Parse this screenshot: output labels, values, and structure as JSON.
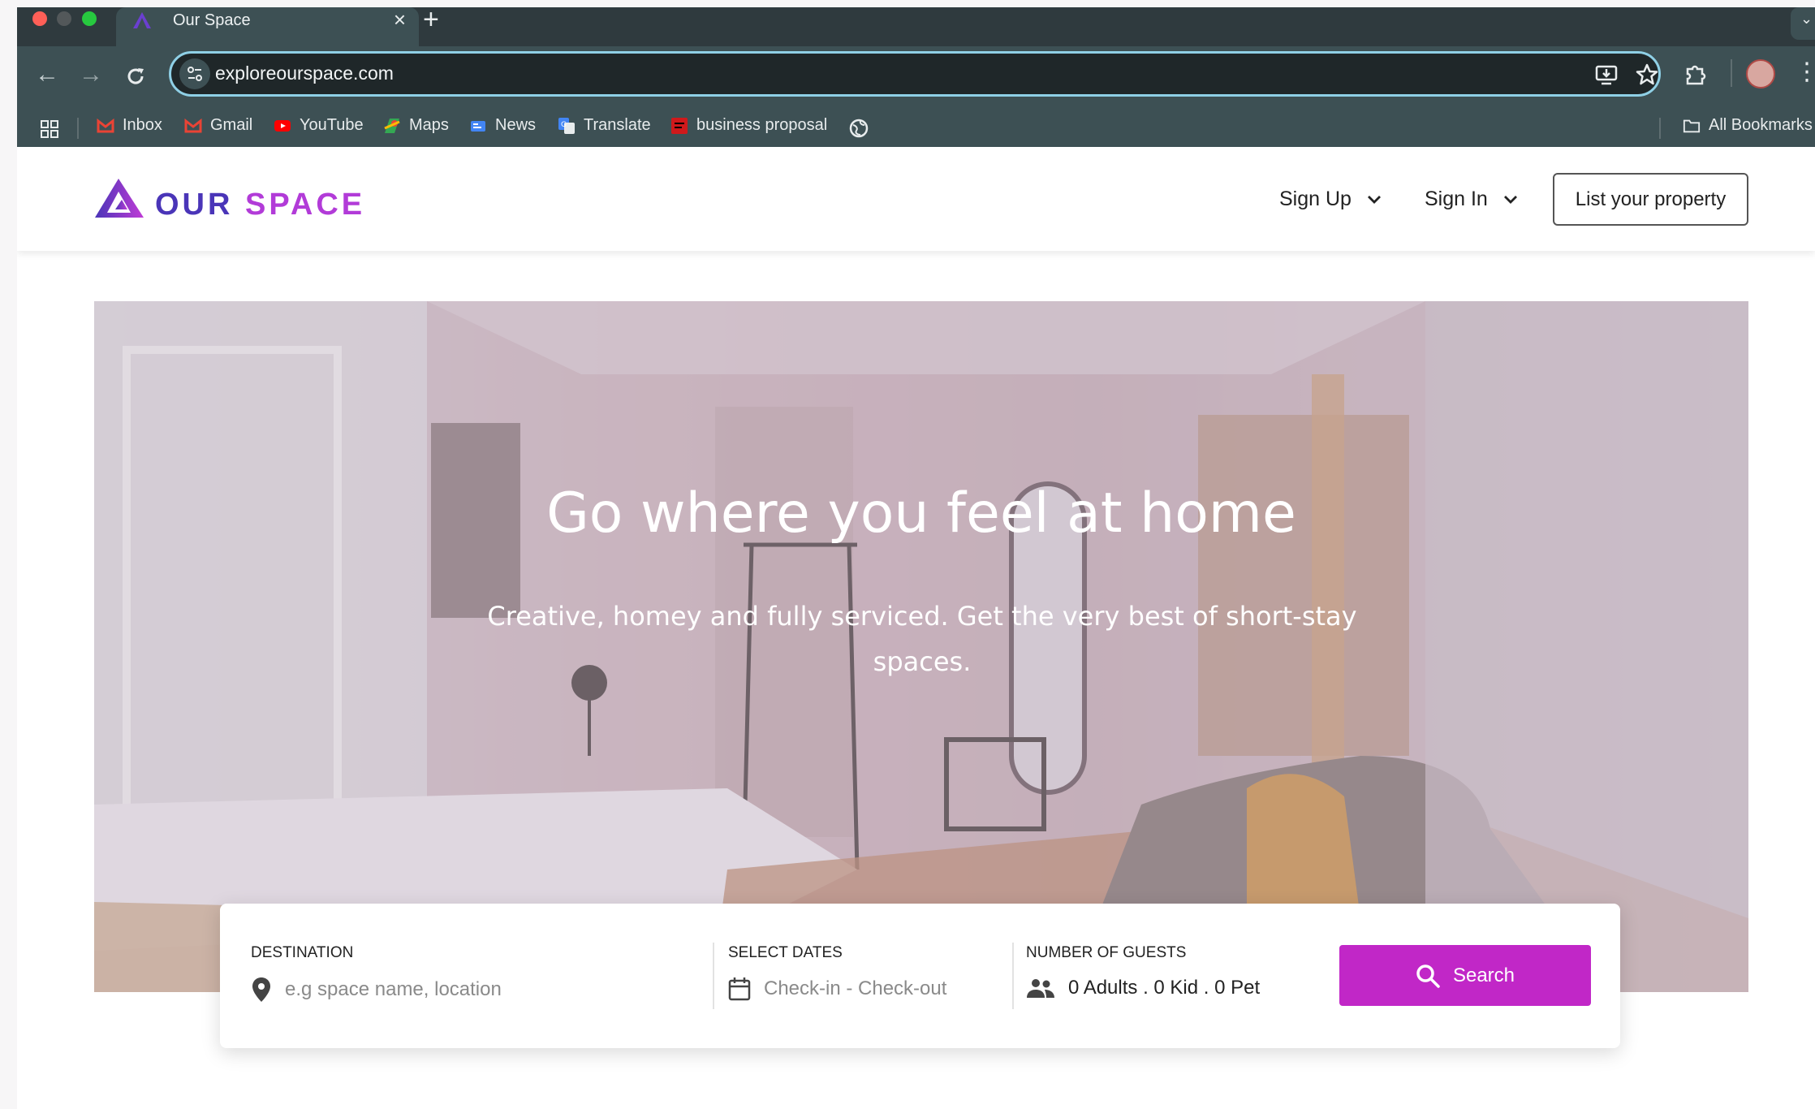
{
  "browser": {
    "tab_title": "Our Space",
    "url": "exploreourspace.com",
    "bookmarks": [
      {
        "label": "Inbox",
        "icon": "gmail-icon"
      },
      {
        "label": "Gmail",
        "icon": "gmail-icon"
      },
      {
        "label": "YouTube",
        "icon": "youtube-icon"
      },
      {
        "label": "Maps",
        "icon": "maps-icon"
      },
      {
        "label": "News",
        "icon": "news-icon"
      },
      {
        "label": "Translate",
        "icon": "translate-icon"
      },
      {
        "label": "business proposal",
        "icon": "document-icon"
      }
    ],
    "all_bookmarks": "All Bookmarks"
  },
  "site": {
    "logo_our": "OUR",
    "logo_space": "SPACE",
    "nav": {
      "sign_up": "Sign Up",
      "sign_in": "Sign In",
      "list_property": "List your property"
    }
  },
  "hero": {
    "title": "Go where you feel at home",
    "subtitle": "Creative, homey and fully serviced. Get the very best of short-stay spaces."
  },
  "search": {
    "destination_label": "DESTINATION",
    "destination_placeholder": "e.g space name, location",
    "dates_label": "SELECT DATES",
    "dates_placeholder": "Check-in - Check-out",
    "guests_label": "NUMBER OF GUESTS",
    "guests_value": "0 Adults . 0 Kid . 0 Pet",
    "button_label": "Search"
  },
  "colors": {
    "brand_blue": "#4a35b8",
    "brand_purple": "#b23bd8",
    "search_button": "#c127c7",
    "browser_chrome": "#3d5054"
  }
}
